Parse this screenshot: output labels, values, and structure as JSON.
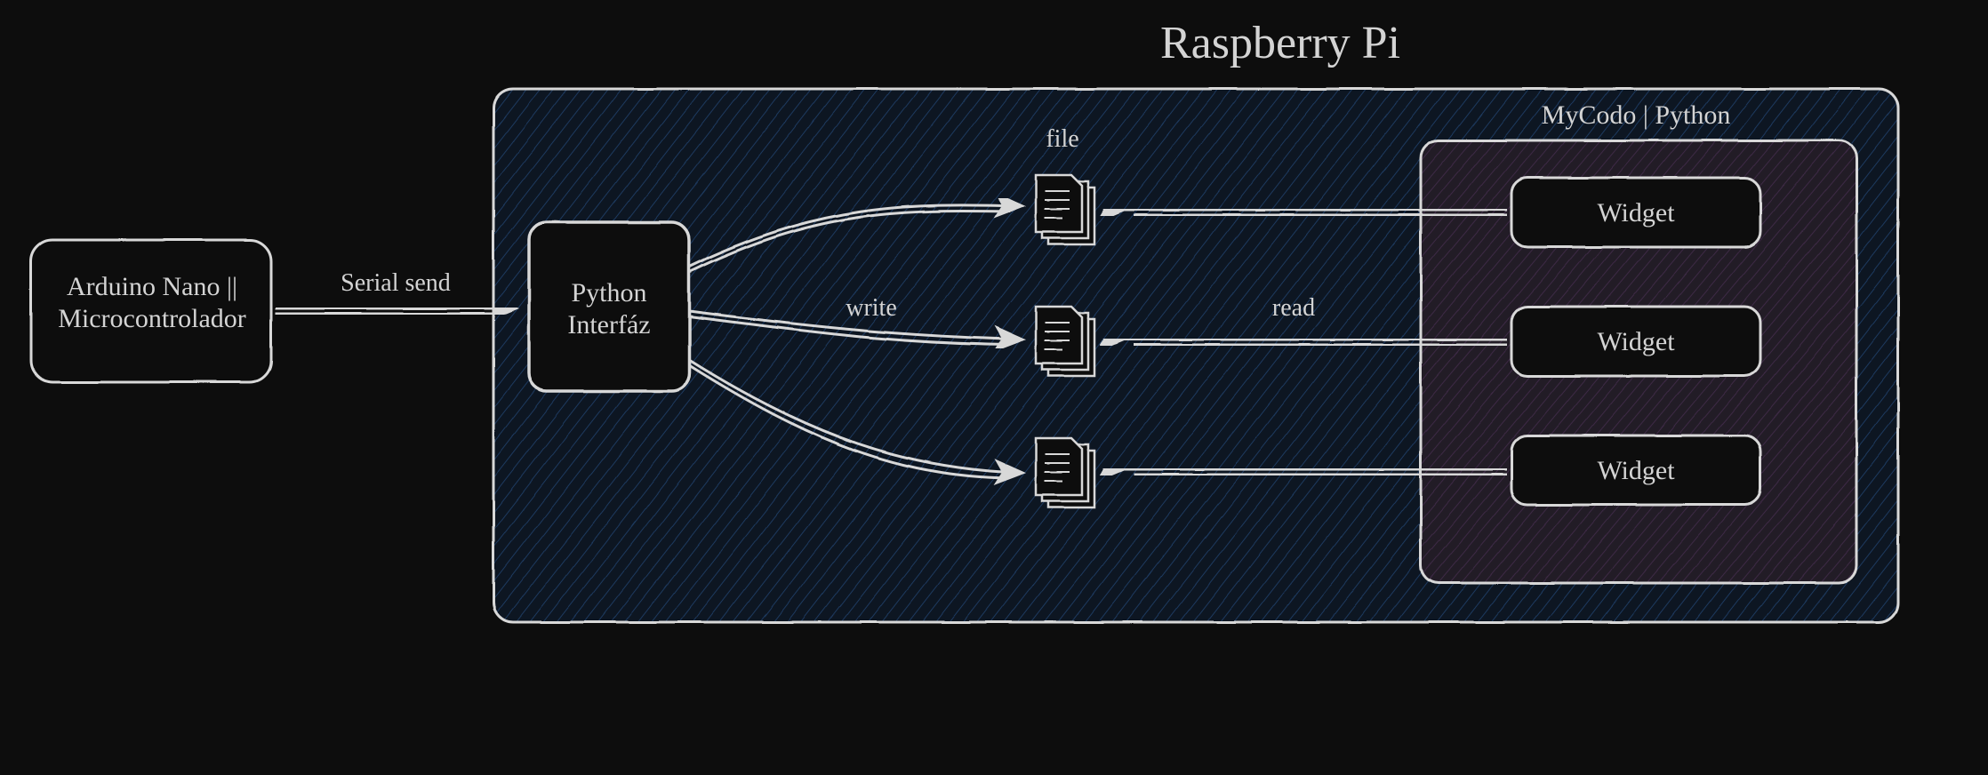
{
  "title": "Raspberry Pi",
  "arduino_box": "Arduino Nano ||\nMicrocontrolador",
  "serial_label": "Serial send",
  "python_box": "Python\nInterfáz",
  "write_label": "write",
  "read_label": "read",
  "file_label": "file",
  "mycodo_label": "MyCodo | Python",
  "widgets": [
    "Widget",
    "Widget",
    "Widget"
  ],
  "colors": {
    "stroke": "#d8d8d8",
    "rpi_fill": "#101a2a",
    "black_fill": "#0f0f0f",
    "mycodo_fill": "#2a1e2e"
  }
}
